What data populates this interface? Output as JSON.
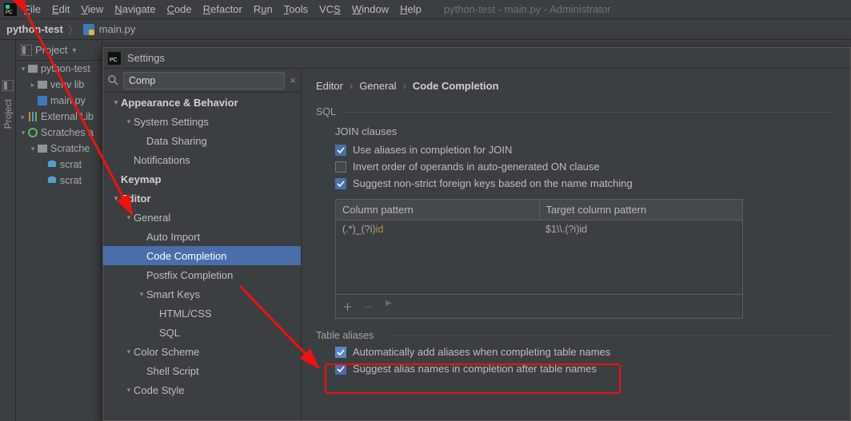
{
  "menubar": {
    "items": [
      "File",
      "Edit",
      "View",
      "Navigate",
      "Code",
      "Refactor",
      "Run",
      "Tools",
      "VCS",
      "Window",
      "Help"
    ],
    "window_title": "python-test - main.py - Administrator"
  },
  "crumbs": {
    "project": "python-test",
    "file": "main.py"
  },
  "gutter": {
    "label": "Project"
  },
  "project_tool": {
    "header": "Project",
    "tree": [
      {
        "level": 0,
        "arrow": "▾",
        "icon": "folder",
        "label": "python-test"
      },
      {
        "level": 1,
        "arrow": "▸",
        "icon": "folder",
        "label": "venv  lib"
      },
      {
        "level": 1,
        "arrow": "",
        "icon": "pyfile",
        "label": "main.py"
      },
      {
        "level": 0,
        "arrow": "▸",
        "icon": "lib",
        "label": "External Lib"
      },
      {
        "level": 0,
        "arrow": "▾",
        "icon": "scratch",
        "label": "Scratches a"
      },
      {
        "level": 1,
        "arrow": "▾",
        "icon": "folder",
        "label": "Scratche"
      },
      {
        "level": 2,
        "arrow": "",
        "icon": "db",
        "label": "scrat"
      },
      {
        "level": 2,
        "arrow": "",
        "icon": "db",
        "label": "scrat"
      }
    ]
  },
  "settings": {
    "title": "Settings",
    "search": {
      "value": "Comp",
      "clear_glyph": "×"
    },
    "nav": [
      {
        "level": 0,
        "arrow": "▾",
        "label": "Appearance & Behavior",
        "top": true
      },
      {
        "level": 1,
        "arrow": "▾",
        "label": "System Settings"
      },
      {
        "level": 2,
        "arrow": "",
        "label": "Data Sharing"
      },
      {
        "level": 1,
        "arrow": "",
        "label": "Notifications"
      },
      {
        "level": 0,
        "arrow": "",
        "label": "Keymap",
        "top": true
      },
      {
        "level": 0,
        "arrow": "▾",
        "label": "Editor",
        "top": true
      },
      {
        "level": 1,
        "arrow": "▾",
        "label": "General"
      },
      {
        "level": 2,
        "arrow": "",
        "label": "Auto Import"
      },
      {
        "level": 2,
        "arrow": "",
        "label": "Code Completion",
        "selected": true
      },
      {
        "level": 2,
        "arrow": "",
        "label": "Postfix Completion"
      },
      {
        "level": 2,
        "arrow": "▾",
        "label": "Smart Keys"
      },
      {
        "level": 3,
        "arrow": "",
        "label": "HTML/CSS"
      },
      {
        "level": 3,
        "arrow": "",
        "label": "SQL"
      },
      {
        "level": 1,
        "arrow": "▾",
        "label": "Color Scheme"
      },
      {
        "level": 2,
        "arrow": "",
        "label": "Shell Script"
      },
      {
        "level": 1,
        "arrow": "▾",
        "label": "Code Style"
      }
    ],
    "breadcrumb": [
      "Editor",
      "General",
      "Code Completion"
    ],
    "sql_section": "SQL",
    "join_header": "JOIN clauses",
    "checks": {
      "c1": {
        "on": true,
        "label": "Use aliases in completion for JOIN"
      },
      "c2": {
        "on": false,
        "label": "Invert order of operands in auto-generated ON clause"
      },
      "c3": {
        "on": true,
        "label": "Suggest non-strict foreign keys based on the name matching"
      }
    },
    "table": {
      "h1": "Column pattern",
      "h2": "Target column pattern",
      "r1a_plain": "(.*)_(?i)",
      "r1a_hl": "id",
      "r1b": "$1\\\\.(?i)id",
      "tools": {
        "add": "＋",
        "remove": "－",
        "play": "▶"
      }
    },
    "table_aliases_header": "Table aliases",
    "aliases": {
      "a1": {
        "on": true,
        "label": "Automatically add aliases when completing table names"
      },
      "a2": {
        "on": true,
        "label": "Suggest alias names in completion after table names"
      }
    }
  }
}
